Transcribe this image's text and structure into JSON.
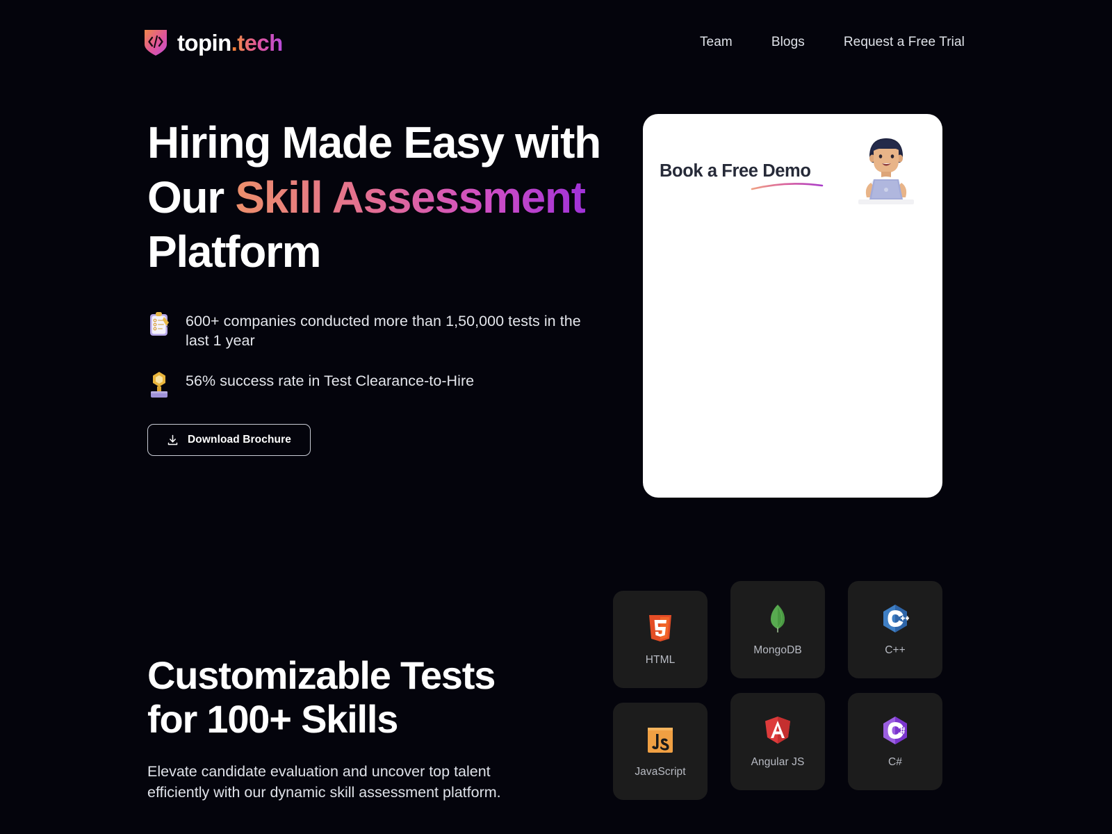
{
  "header": {
    "brand": {
      "word1": "topin",
      "dot": ".",
      "word2": "tech",
      "logo_icon": "code-shield-icon"
    },
    "nav": [
      {
        "label": "Team"
      },
      {
        "label": "Blogs"
      },
      {
        "label": "Request a Free Trial"
      }
    ]
  },
  "hero": {
    "title_line1": "Hiring Made Easy with",
    "title_line2_plain": "Our ",
    "title_line2_gradient": "Skill Assessment",
    "title_line3": "Platform",
    "stats": [
      {
        "icon": "clipboard-checklist-icon",
        "text": "600+ companies conducted more than 1,50,000 tests in the last 1 year"
      },
      {
        "icon": "trophy-icon",
        "text": "56% success rate in Test Clearance-to-Hire"
      }
    ],
    "download_button": {
      "label": "Download Brochure",
      "icon": "download-icon"
    }
  },
  "demo_card": {
    "title": "Book a Free Demo",
    "illustration": "person-at-laptop-illustration",
    "underline": "gradient-swoosh-underline"
  },
  "skills_section": {
    "title_line1": "Customizable Tests",
    "title_line2": "for 100+ Skills",
    "description": "Elevate candidate evaluation and uncover top talent efficiently with our dynamic skill assessment platform.",
    "columns": [
      {
        "cards": [
          {
            "label": "HTML",
            "icon": "html5-icon"
          },
          {
            "label": "JavaScript",
            "icon": "javascript-icon"
          }
        ]
      },
      {
        "cards": [
          {
            "label": "MongoDB",
            "icon": "mongodb-icon"
          },
          {
            "label": "Angular JS",
            "icon": "angularjs-icon"
          }
        ]
      },
      {
        "cards": [
          {
            "label": "C++",
            "icon": "cplusplus-icon"
          },
          {
            "label": "C#",
            "icon": "csharp-icon"
          }
        ]
      }
    ]
  },
  "colors": {
    "background": "#04040c",
    "card_background": "#1c1c1c",
    "accent_orange": "#ec8f6b",
    "accent_pink": "#e0559b",
    "accent_purple": "#a032d8",
    "text_primary": "#ffffff",
    "text_secondary": "#dfe2e9",
    "demo_card_background": "#ffffff"
  }
}
